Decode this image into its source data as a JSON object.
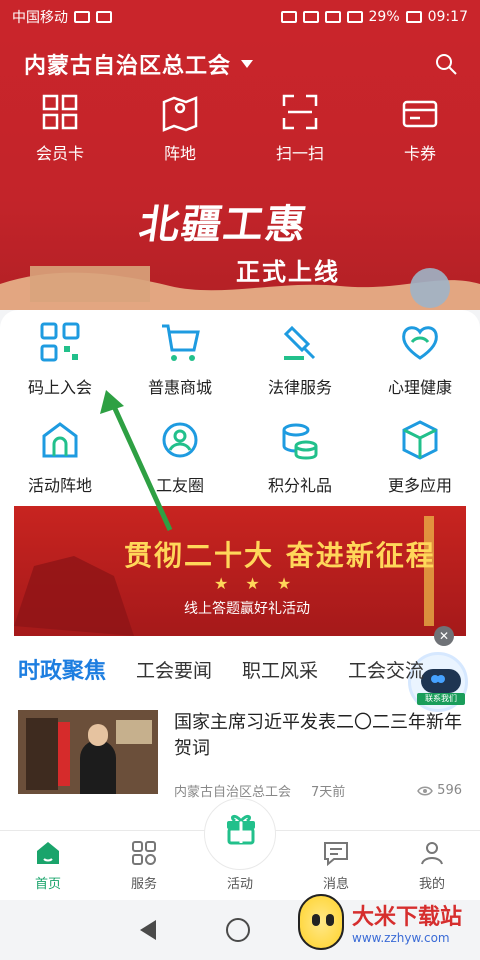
{
  "status": {
    "carrier": "中国移动",
    "battery": "29%",
    "time": "09:17"
  },
  "header": {
    "title": "内蒙古自治区总工会"
  },
  "quick_actions": [
    {
      "label": "会员卡",
      "icon": "grid-icon"
    },
    {
      "label": "阵地",
      "icon": "map-pin-icon"
    },
    {
      "label": "扫一扫",
      "icon": "scan-icon"
    },
    {
      "label": "卡券",
      "icon": "card-icon"
    }
  ],
  "hero": {
    "title": "北疆工惠",
    "subtitle": "正式上线"
  },
  "services": [
    {
      "label": "码上入会",
      "icon": "qrcode-icon"
    },
    {
      "label": "普惠商城",
      "icon": "cart-icon"
    },
    {
      "label": "法律服务",
      "icon": "law-icon"
    },
    {
      "label": "心理健康",
      "icon": "heart-icon"
    },
    {
      "label": "活动阵地",
      "icon": "house-icon"
    },
    {
      "label": "工友圈",
      "icon": "people-icon"
    },
    {
      "label": "积分礼品",
      "icon": "coins-icon"
    },
    {
      "label": "更多应用",
      "icon": "cube-icon"
    }
  ],
  "promo": {
    "title": "贯彻二十大 奋进新征程",
    "stars": "★ ★ ★",
    "subtitle": "线上答题赢好礼活动"
  },
  "robot": {
    "label": "联系我们"
  },
  "tabs": [
    {
      "label": "时政聚焦",
      "active": true
    },
    {
      "label": "工会要闻",
      "active": false
    },
    {
      "label": "职工风采",
      "active": false
    },
    {
      "label": "工会交流",
      "active": false
    }
  ],
  "news": {
    "title": "国家主席习近平发表二〇二三年新年贺词",
    "source": "内蒙古自治区总工会",
    "time": "7天前",
    "views": "596"
  },
  "bottom_nav": [
    {
      "label": "首页",
      "icon": "home-icon",
      "active": true
    },
    {
      "label": "服务",
      "icon": "services-icon",
      "active": false
    },
    {
      "label": "活动",
      "icon": "gift-icon",
      "active": false
    },
    {
      "label": "消息",
      "icon": "message-icon",
      "active": false
    },
    {
      "label": "我的",
      "icon": "user-icon",
      "active": false
    }
  ],
  "watermark": {
    "big": "大米下载站",
    "small": "www.zzhyw.com"
  },
  "colors": {
    "brand_red": "#c9252b",
    "accent_blue": "#1d7ee0",
    "accent_green": "#1aa46b"
  }
}
